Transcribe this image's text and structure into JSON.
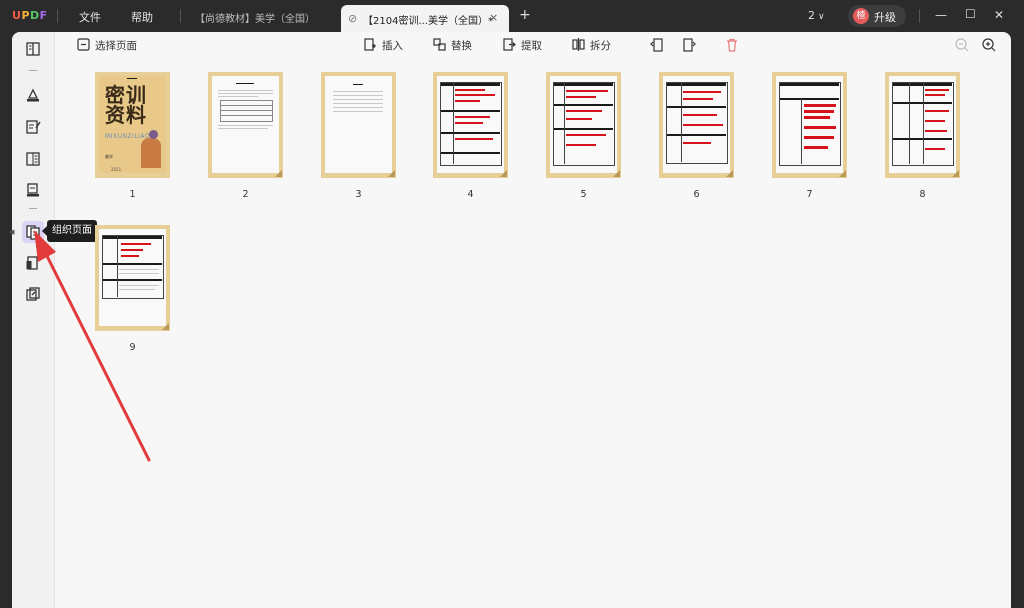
{
  "app": {
    "logo": "UPDF",
    "menu": [
      "文件",
      "帮助"
    ]
  },
  "tabs": {
    "inactive": "【尚德教材】美学（全国）",
    "active": "【2104密训...美学（全国）*",
    "close": "×",
    "new_tab": "+"
  },
  "titlebar": {
    "page_count": "2",
    "upgrade_avatar": "楂",
    "upgrade_label": "升级"
  },
  "toolbar": {
    "select_pages": "选择页面",
    "insert": "插入",
    "replace": "替换",
    "extract": "提取",
    "split": "拆分"
  },
  "sidebar": {
    "tooltip": "组织页面"
  },
  "cover": {
    "title_line1": "密训",
    "title_line2": "资料",
    "subtitle": "MIXUNZILIAO",
    "brand": "美学",
    "year": "2021"
  },
  "pages": [
    {
      "number": "1",
      "kind": "cover"
    },
    {
      "number": "2",
      "kind": "table"
    },
    {
      "number": "3",
      "kind": "toc"
    },
    {
      "number": "4",
      "kind": "redtable"
    },
    {
      "number": "5",
      "kind": "redtable"
    },
    {
      "number": "6",
      "kind": "redtable"
    },
    {
      "number": "7",
      "kind": "redtable"
    },
    {
      "number": "8",
      "kind": "redtable"
    },
    {
      "number": "9",
      "kind": "redtable"
    }
  ],
  "colors": {
    "accent_purple": "#8b6cf0",
    "arrow_red": "#e23b3b",
    "thumb_border": "#e8cf98"
  }
}
